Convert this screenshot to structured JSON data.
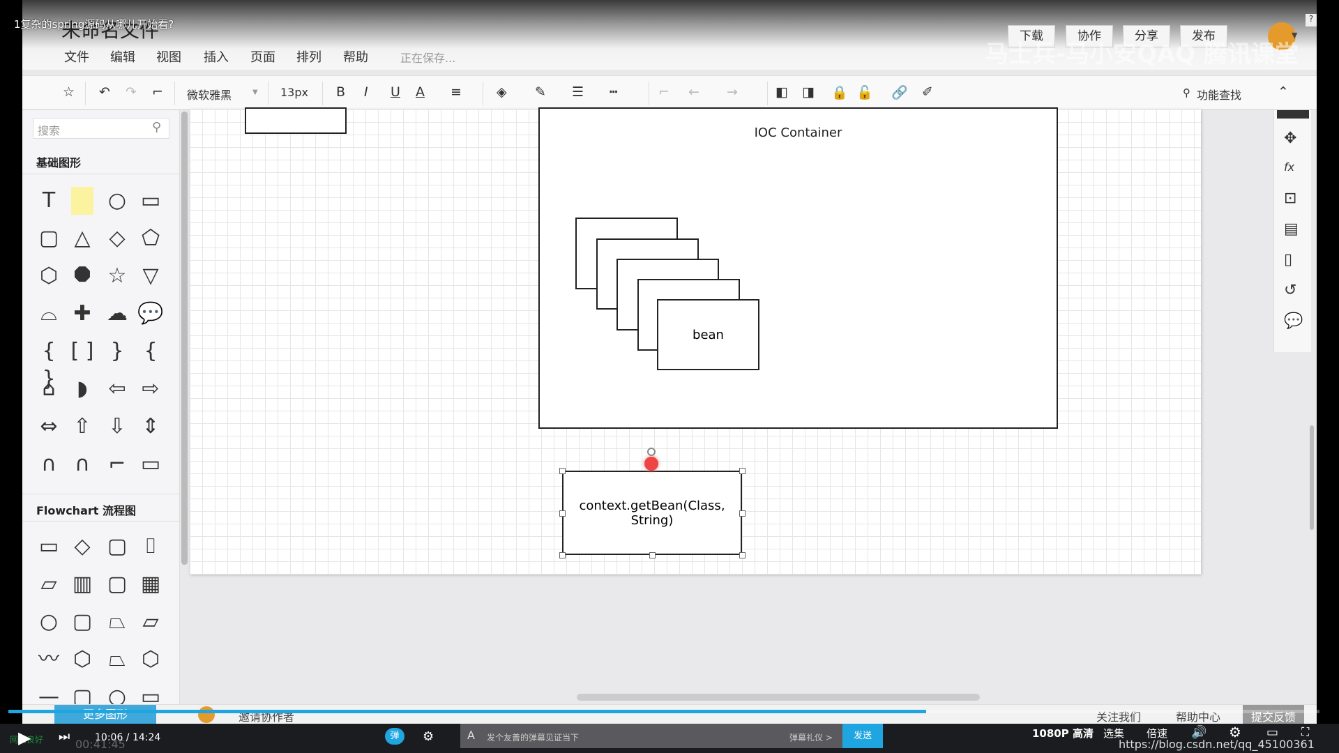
{
  "video_title": "1复杂的spring源码从哪儿开始看?",
  "doc_title": "未命名文件",
  "menu": [
    "文件",
    "编辑",
    "视图",
    "插入",
    "页面",
    "排列",
    "帮助"
  ],
  "saving_status": "正在保存...",
  "header_buttons": [
    "下载",
    "协作",
    "分享",
    "发布"
  ],
  "watermark": "马士兵-马小安QAQ 腾讯课堂",
  "toolbar": {
    "font": "微软雅黑",
    "size": "13px",
    "bold": "B",
    "italic": "I",
    "underline": "U",
    "font_color": "A",
    "search_label": "功能查找"
  },
  "sidebar": {
    "search_placeholder": "搜索",
    "section_basic": "基础图形",
    "section_flowchart": "Flowchart 流程图",
    "more_shapes": "更多图形"
  },
  "canvas": {
    "container_label": "IOC  Container",
    "bean_label": "bean",
    "selected_text": "context.getBean(Class, String)"
  },
  "bottom": {
    "invite": "邀请协作者",
    "follow": "关注我们",
    "help": "帮助中心",
    "feedback": "提交反馈"
  },
  "player": {
    "time": "10:06 / 14:24",
    "progress": 0.7,
    "danmaku_placeholder": "发个友善的弹幕见证当下",
    "danmaku_etiquette": "弹幕礼仪 >",
    "send": "发送",
    "quality": "1080P 高清",
    "episodes": "选集",
    "speed": "倍速",
    "url_watermark": "https://blog.csdn.net/qq_45100361",
    "network": "网络良好",
    "elapsed": "00:41:45"
  },
  "colors": {
    "accent": "#1fa5e0",
    "player_bg": "#1b1c1f"
  }
}
